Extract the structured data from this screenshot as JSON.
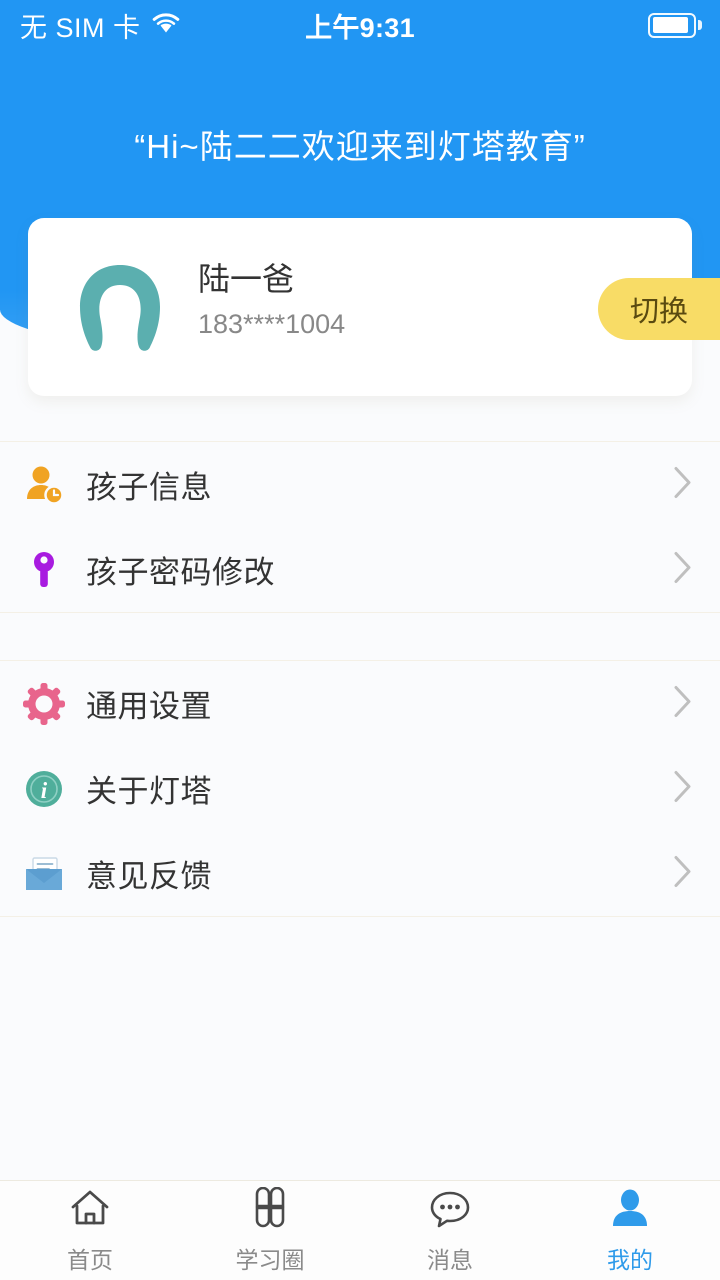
{
  "status_bar": {
    "carrier": "无 SIM 卡",
    "wifi_icon": "wifi-icon",
    "time": "上午9:31",
    "battery_icon": "battery-icon"
  },
  "header": {
    "greeting": "“Hi~陆二二欢迎来到灯塔教育”",
    "background_color": "#2196F3"
  },
  "profile": {
    "avatar_icon": "avatar-person-icon",
    "avatar_color": "#5BAFAF",
    "name": "陆一爸",
    "phone": "183****1004",
    "switch_label": "切换",
    "switch_color": "#F8DC66"
  },
  "menu_groups": [
    {
      "id": "group-1",
      "items": [
        {
          "icon": "child-info-icon",
          "icon_color": "#F0A323",
          "label": "孩子信息",
          "chevron": "chevron-right-icon"
        },
        {
          "icon": "key-icon",
          "icon_color": "#A81BE0",
          "label": "孩子密码修改",
          "chevron": "chevron-right-icon"
        }
      ]
    },
    {
      "id": "group-2",
      "items": [
        {
          "icon": "gear-icon",
          "icon_color": "#E8658C",
          "label": "通用设置",
          "chevron": "chevron-right-icon"
        },
        {
          "icon": "info-circle-icon",
          "icon_color": "#4FAE9B",
          "label": "关于灯塔",
          "chevron": "chevron-right-icon"
        },
        {
          "icon": "envelope-icon",
          "icon_color": "#69A9D8",
          "label": "意见反馈",
          "chevron": "chevron-right-icon"
        }
      ]
    }
  ],
  "bottom_nav": {
    "active_color": "#2F9BEA",
    "inactive_color": "#8A8A8A",
    "items": [
      {
        "icon": "home-icon",
        "label": "首页",
        "active": false
      },
      {
        "icon": "clover-icon",
        "label": "学习圈",
        "active": false
      },
      {
        "icon": "chat-bubble-icon",
        "label": "消息",
        "active": false
      },
      {
        "icon": "person-icon",
        "label": "我的",
        "active": true
      }
    ]
  }
}
